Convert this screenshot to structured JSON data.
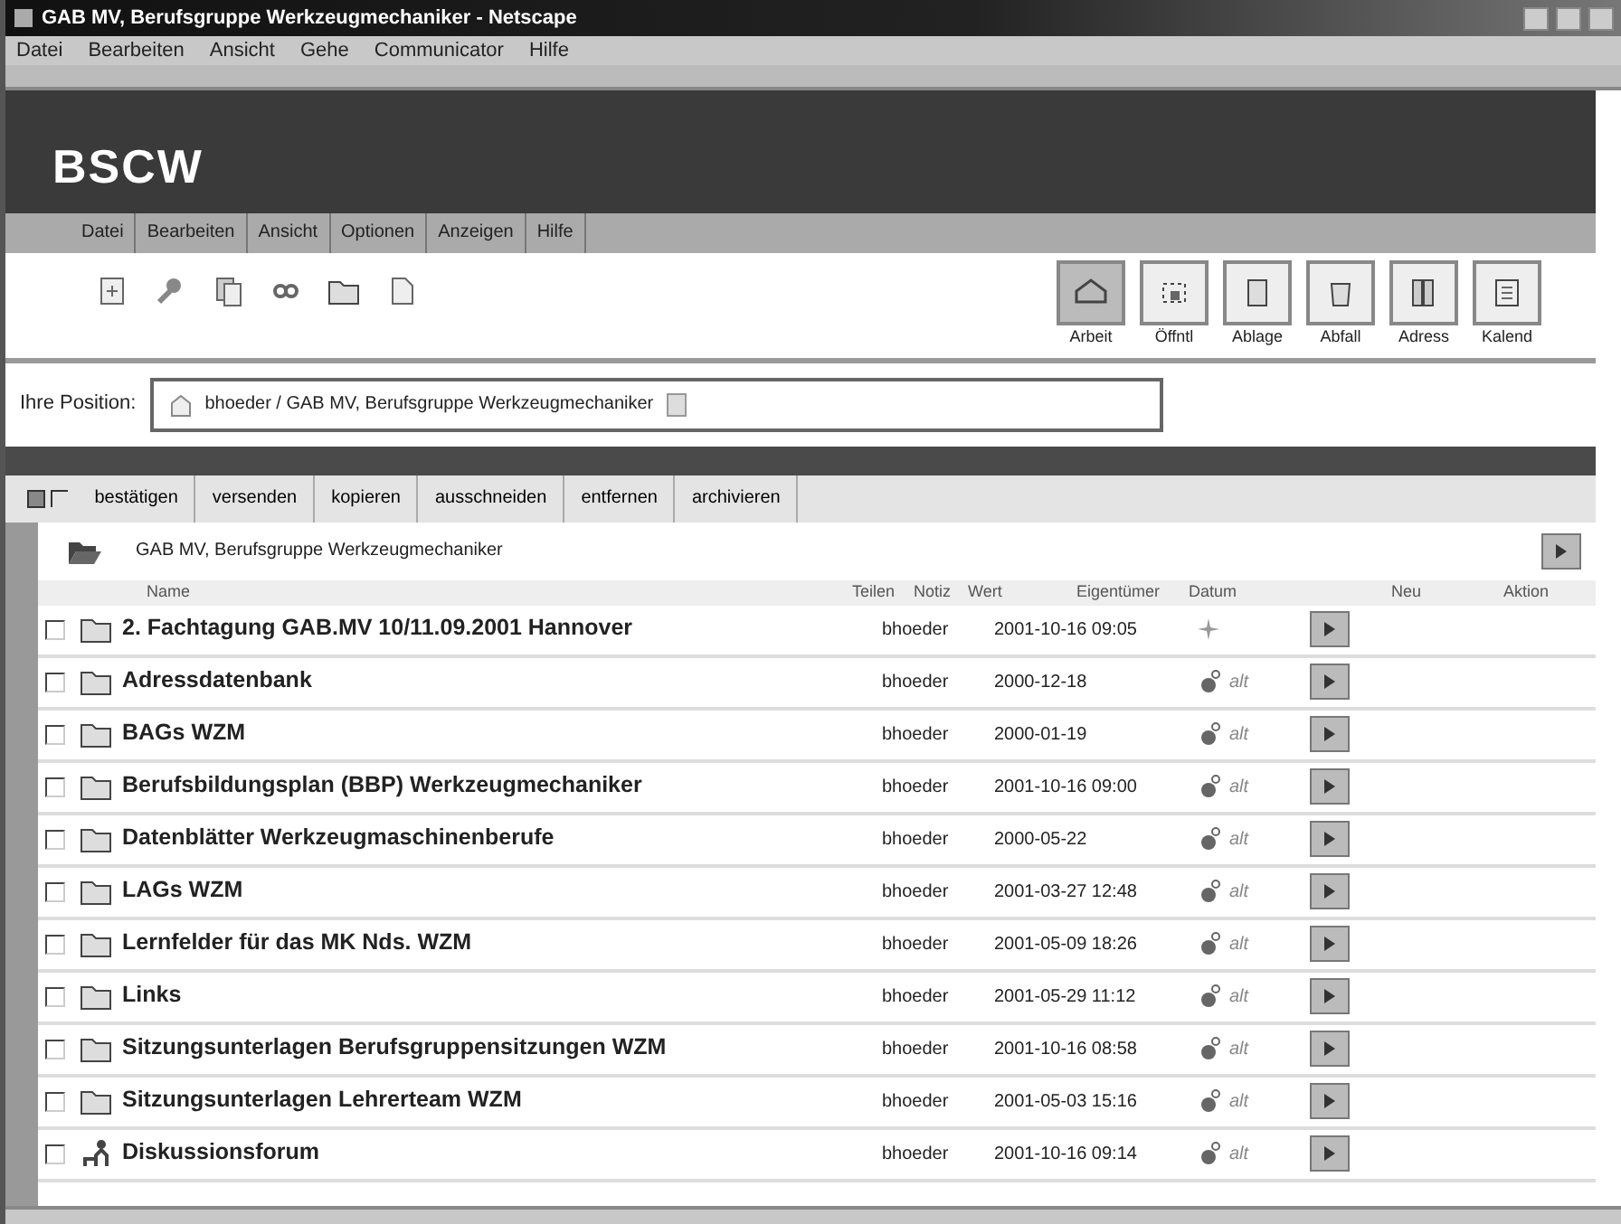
{
  "window": {
    "title": "GAB MV, Berufsgruppe Werkzeugmechaniker - Netscape"
  },
  "browser_menu": [
    "Datei",
    "Bearbeiten",
    "Ansicht",
    "Gehe",
    "Communicator",
    "Hilfe"
  ],
  "logo": "BSCW",
  "bscw_menu": [
    "Datei",
    "Bearbeiten",
    "Ansicht",
    "Optionen",
    "Anzeigen",
    "Hilfe"
  ],
  "nav_buttons": [
    {
      "label": "Arbeit",
      "selected": true
    },
    {
      "label": "Öffntl",
      "selected": false
    },
    {
      "label": "Ablage",
      "selected": false
    },
    {
      "label": "Abfall",
      "selected": false
    },
    {
      "label": "Adress",
      "selected": false
    },
    {
      "label": "Kalend",
      "selected": false
    }
  ],
  "position": {
    "label": "Ihre Position:",
    "path": "bhoeder / GAB MV, Berufsgruppe Werkzeugmechaniker"
  },
  "actions": [
    "bestätigen",
    "versenden",
    "kopieren",
    "ausschneiden",
    "entfernen",
    "archivieren"
  ],
  "folder": "GAB MV, Berufsgruppe Werkzeugmechaniker",
  "columns": [
    "Name",
    "Teilen",
    "Notiz",
    "Wert",
    "Eigentümer",
    "Datum",
    "Neu",
    "Aktion"
  ],
  "rows": [
    {
      "kind": "folder",
      "checked": false,
      "name": "2. Fachtagung GAB.MV 10/11.09.2001 Hannover",
      "owner": "bhoeder",
      "date": "2001-10-16 09:05",
      "new": true
    },
    {
      "kind": "folder",
      "checked": false,
      "name": "Adressdatenbank",
      "owner": "bhoeder",
      "date": "2000-12-18",
      "new": false,
      "status_text": "alt"
    },
    {
      "kind": "folder",
      "checked": false,
      "name": "BAGs WZM",
      "owner": "bhoeder",
      "date": "2000-01-19",
      "new": false,
      "status_text": "alt"
    },
    {
      "kind": "folder",
      "checked": false,
      "name": "Berufsbildungsplan (BBP) Werkzeugmechaniker",
      "owner": "bhoeder",
      "date": "2001-10-16 09:00",
      "new": false,
      "status_text": "alt"
    },
    {
      "kind": "folder",
      "checked": false,
      "name": "Datenblätter Werkzeugmaschinenberufe",
      "owner": "bhoeder",
      "date": "2000-05-22",
      "new": false,
      "status_text": "alt"
    },
    {
      "kind": "folder",
      "checked": false,
      "name": "LAGs WZM",
      "owner": "bhoeder",
      "date": "2001-03-27 12:48",
      "new": false,
      "status_text": "alt"
    },
    {
      "kind": "folder",
      "checked": false,
      "name": "Lernfelder für das MK Nds. WZM",
      "owner": "bhoeder",
      "date": "2001-05-09 18:26",
      "new": false,
      "status_text": "alt"
    },
    {
      "kind": "folder",
      "checked": false,
      "name": "Links",
      "owner": "bhoeder",
      "date": "2001-05-29 11:12",
      "new": false,
      "status_text": "alt"
    },
    {
      "kind": "folder",
      "checked": false,
      "name": "Sitzungsunterlagen Berufsgruppensitzungen WZM",
      "owner": "bhoeder",
      "date": "2001-10-16 08:58",
      "new": false,
      "status_text": "alt"
    },
    {
      "kind": "folder",
      "checked": false,
      "name": "Sitzungsunterlagen Lehrerteam WZM",
      "owner": "bhoeder",
      "date": "2001-05-03 15:16",
      "new": false,
      "status_text": "alt"
    },
    {
      "kind": "forum",
      "checked": false,
      "name": "Diskussionsforum",
      "owner": "bhoeder",
      "date": "2001-10-16 09:14",
      "new": false,
      "status_text": "alt"
    }
  ]
}
